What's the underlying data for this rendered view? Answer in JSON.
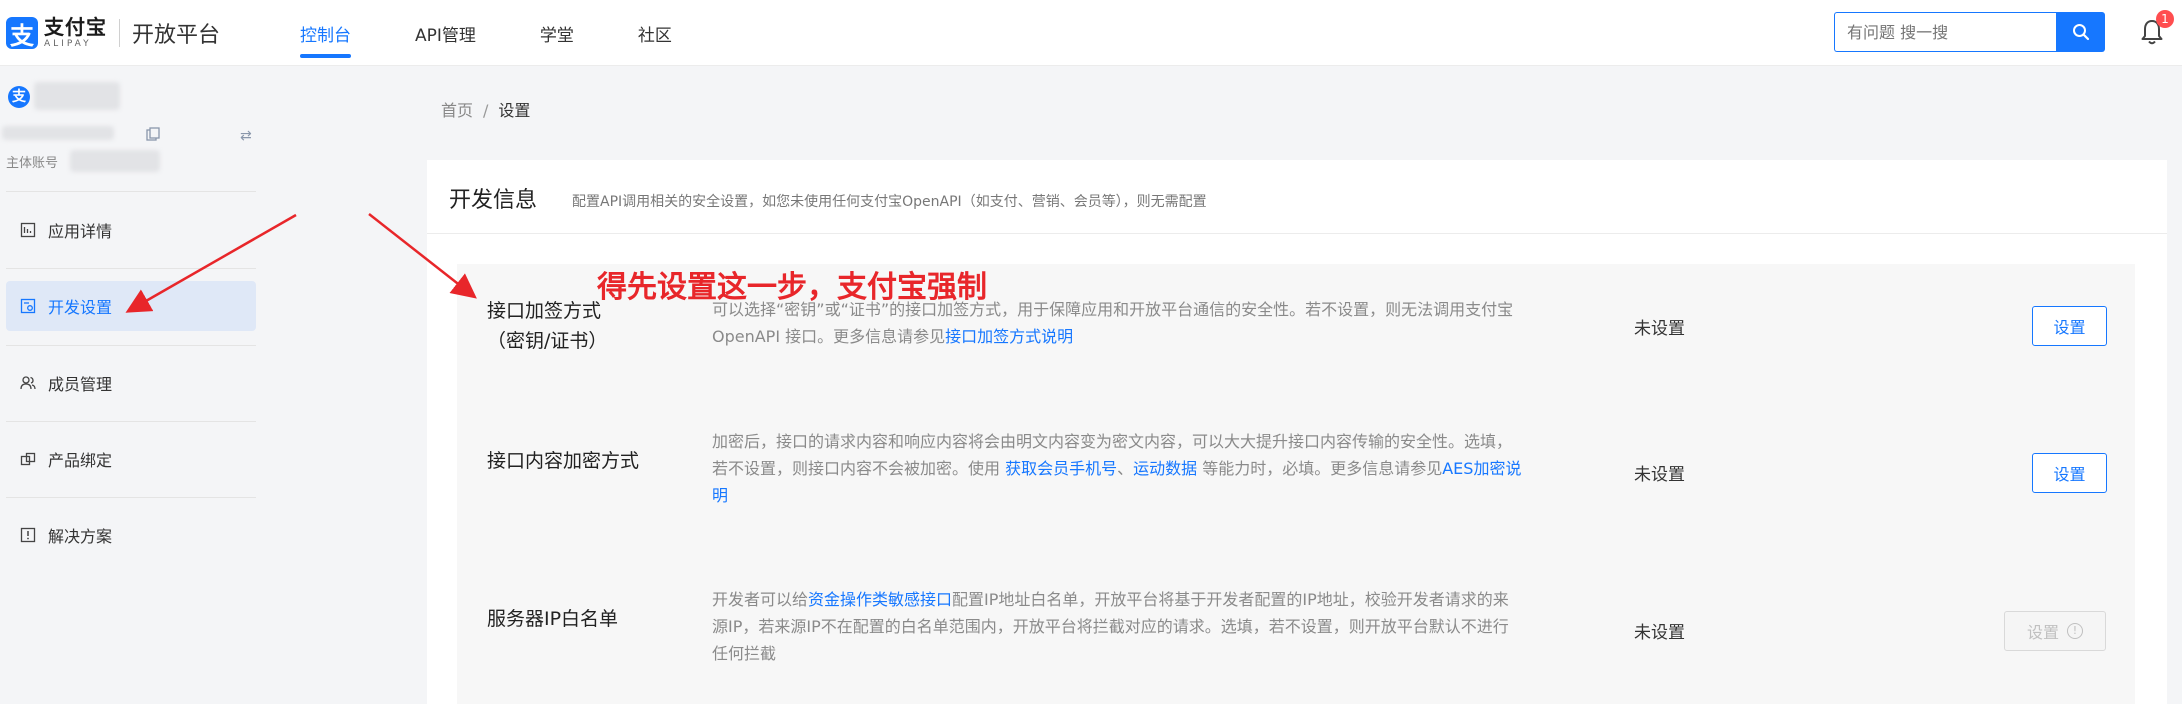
{
  "brand": {
    "logo_glyph": "支",
    "name_cn": "支付宝",
    "name_en": "ALIPAY",
    "platform": "开放平台",
    "color": "#1677ff"
  },
  "nav": {
    "tabs": [
      {
        "label": "控制台",
        "active": true
      },
      {
        "label": "API管理",
        "active": false
      },
      {
        "label": "学堂",
        "active": false
      },
      {
        "label": "社区",
        "active": false
      }
    ]
  },
  "search": {
    "placeholder": "有问题 搜一搜",
    "icon": "search-icon"
  },
  "notifications": {
    "count": "1",
    "icon": "bell-icon"
  },
  "account": {
    "icon_glyph": "支",
    "label": "主体账号"
  },
  "sidebar": {
    "items": [
      {
        "label": "应用详情",
        "icon": "app-detail-icon",
        "active": false
      },
      {
        "label": "开发设置",
        "icon": "dev-settings-icon",
        "active": true
      },
      {
        "label": "成员管理",
        "icon": "members-icon",
        "active": false
      },
      {
        "label": "产品绑定",
        "icon": "product-binding-icon",
        "active": false
      },
      {
        "label": "解决方案",
        "icon": "solution-icon",
        "active": false
      }
    ]
  },
  "breadcrumb": {
    "home": "首页",
    "separator": "/",
    "current": "设置"
  },
  "section": {
    "title": "开发信息",
    "desc": "配置API调用相关的安全设置，如您未使用任何支付宝OpenAPI（如支付、营销、会员等），则无需配置"
  },
  "annotation": "得先设置这一步，支付宝强制",
  "rows": [
    {
      "label_line1": "接口加签方式",
      "label_line2": "（密钥/证书）",
      "desc_parts": {
        "text1": "可以选择“密钥”或“证书”的接口加签方式，用于保障应用和开放平台通信的安全性。若不设置，则无法调用支付宝 OpenAPI 接口。更多信息请参见",
        "link1": "接口加签方式说明"
      },
      "status": "未设置",
      "button": "设置",
      "button_enabled": true
    },
    {
      "label": "接口内容加密方式",
      "desc_parts": {
        "text1": "加密后，接口的请求内容和响应内容将会由明文内容变为密文内容，可以大大提升接口内容传输的安全性。选填，若不设置，则接口内容不会被加密。使用 ",
        "link1": "获取会员手机号",
        "text2": "、",
        "link2": "运动数据",
        "text3": " 等能力时，必填。更多信息请参见",
        "link3": "AES加密说明"
      },
      "status": "未设置",
      "button": "设置",
      "button_enabled": true
    },
    {
      "label": "服务器IP白名单",
      "desc_parts": {
        "text1": "开发者可以给",
        "link1": "资金操作类敏感接口",
        "text2": "配置IP地址白名单，开放平台将基于开发者配置的IP地址，校验开发者请求的来源IP，若来源IP不在配置的白名单范围内，开放平台将拦截对应的请求。选填，若不设置，则开放平台默认不进行任何拦截"
      },
      "status": "未设置",
      "button": "设置",
      "button_enabled": false,
      "button_info_glyph": "!"
    }
  ]
}
